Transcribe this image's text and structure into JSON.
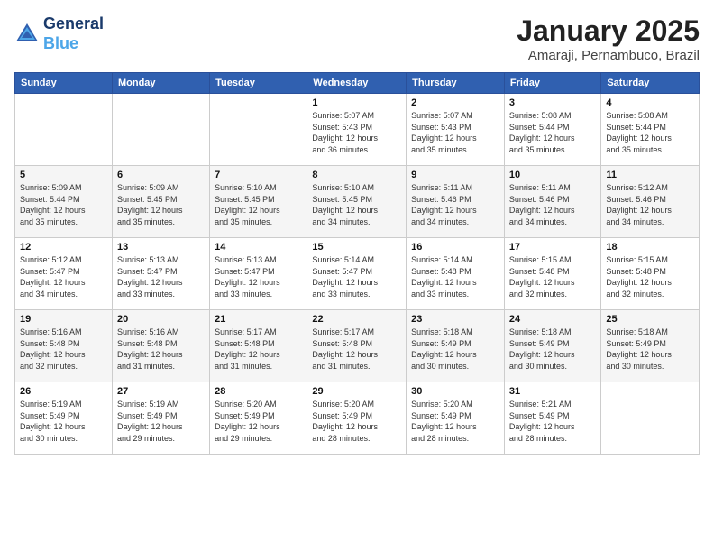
{
  "logo": {
    "line1": "General",
    "line2": "Blue"
  },
  "title": "January 2025",
  "subtitle": "Amaraji, Pernambuco, Brazil",
  "days_of_week": [
    "Sunday",
    "Monday",
    "Tuesday",
    "Wednesday",
    "Thursday",
    "Friday",
    "Saturday"
  ],
  "weeks": [
    [
      {
        "day": "",
        "info": ""
      },
      {
        "day": "",
        "info": ""
      },
      {
        "day": "",
        "info": ""
      },
      {
        "day": "1",
        "info": "Sunrise: 5:07 AM\nSunset: 5:43 PM\nDaylight: 12 hours\nand 36 minutes."
      },
      {
        "day": "2",
        "info": "Sunrise: 5:07 AM\nSunset: 5:43 PM\nDaylight: 12 hours\nand 35 minutes."
      },
      {
        "day": "3",
        "info": "Sunrise: 5:08 AM\nSunset: 5:44 PM\nDaylight: 12 hours\nand 35 minutes."
      },
      {
        "day": "4",
        "info": "Sunrise: 5:08 AM\nSunset: 5:44 PM\nDaylight: 12 hours\nand 35 minutes."
      }
    ],
    [
      {
        "day": "5",
        "info": "Sunrise: 5:09 AM\nSunset: 5:44 PM\nDaylight: 12 hours\nand 35 minutes."
      },
      {
        "day": "6",
        "info": "Sunrise: 5:09 AM\nSunset: 5:45 PM\nDaylight: 12 hours\nand 35 minutes."
      },
      {
        "day": "7",
        "info": "Sunrise: 5:10 AM\nSunset: 5:45 PM\nDaylight: 12 hours\nand 35 minutes."
      },
      {
        "day": "8",
        "info": "Sunrise: 5:10 AM\nSunset: 5:45 PM\nDaylight: 12 hours\nand 34 minutes."
      },
      {
        "day": "9",
        "info": "Sunrise: 5:11 AM\nSunset: 5:46 PM\nDaylight: 12 hours\nand 34 minutes."
      },
      {
        "day": "10",
        "info": "Sunrise: 5:11 AM\nSunset: 5:46 PM\nDaylight: 12 hours\nand 34 minutes."
      },
      {
        "day": "11",
        "info": "Sunrise: 5:12 AM\nSunset: 5:46 PM\nDaylight: 12 hours\nand 34 minutes."
      }
    ],
    [
      {
        "day": "12",
        "info": "Sunrise: 5:12 AM\nSunset: 5:47 PM\nDaylight: 12 hours\nand 34 minutes."
      },
      {
        "day": "13",
        "info": "Sunrise: 5:13 AM\nSunset: 5:47 PM\nDaylight: 12 hours\nand 33 minutes."
      },
      {
        "day": "14",
        "info": "Sunrise: 5:13 AM\nSunset: 5:47 PM\nDaylight: 12 hours\nand 33 minutes."
      },
      {
        "day": "15",
        "info": "Sunrise: 5:14 AM\nSunset: 5:47 PM\nDaylight: 12 hours\nand 33 minutes."
      },
      {
        "day": "16",
        "info": "Sunrise: 5:14 AM\nSunset: 5:48 PM\nDaylight: 12 hours\nand 33 minutes."
      },
      {
        "day": "17",
        "info": "Sunrise: 5:15 AM\nSunset: 5:48 PM\nDaylight: 12 hours\nand 32 minutes."
      },
      {
        "day": "18",
        "info": "Sunrise: 5:15 AM\nSunset: 5:48 PM\nDaylight: 12 hours\nand 32 minutes."
      }
    ],
    [
      {
        "day": "19",
        "info": "Sunrise: 5:16 AM\nSunset: 5:48 PM\nDaylight: 12 hours\nand 32 minutes."
      },
      {
        "day": "20",
        "info": "Sunrise: 5:16 AM\nSunset: 5:48 PM\nDaylight: 12 hours\nand 31 minutes."
      },
      {
        "day": "21",
        "info": "Sunrise: 5:17 AM\nSunset: 5:48 PM\nDaylight: 12 hours\nand 31 minutes."
      },
      {
        "day": "22",
        "info": "Sunrise: 5:17 AM\nSunset: 5:48 PM\nDaylight: 12 hours\nand 31 minutes."
      },
      {
        "day": "23",
        "info": "Sunrise: 5:18 AM\nSunset: 5:49 PM\nDaylight: 12 hours\nand 30 minutes."
      },
      {
        "day": "24",
        "info": "Sunrise: 5:18 AM\nSunset: 5:49 PM\nDaylight: 12 hours\nand 30 minutes."
      },
      {
        "day": "25",
        "info": "Sunrise: 5:18 AM\nSunset: 5:49 PM\nDaylight: 12 hours\nand 30 minutes."
      }
    ],
    [
      {
        "day": "26",
        "info": "Sunrise: 5:19 AM\nSunset: 5:49 PM\nDaylight: 12 hours\nand 30 minutes."
      },
      {
        "day": "27",
        "info": "Sunrise: 5:19 AM\nSunset: 5:49 PM\nDaylight: 12 hours\nand 29 minutes."
      },
      {
        "day": "28",
        "info": "Sunrise: 5:20 AM\nSunset: 5:49 PM\nDaylight: 12 hours\nand 29 minutes."
      },
      {
        "day": "29",
        "info": "Sunrise: 5:20 AM\nSunset: 5:49 PM\nDaylight: 12 hours\nand 28 minutes."
      },
      {
        "day": "30",
        "info": "Sunrise: 5:20 AM\nSunset: 5:49 PM\nDaylight: 12 hours\nand 28 minutes."
      },
      {
        "day": "31",
        "info": "Sunrise: 5:21 AM\nSunset: 5:49 PM\nDaylight: 12 hours\nand 28 minutes."
      },
      {
        "day": "",
        "info": ""
      }
    ]
  ]
}
